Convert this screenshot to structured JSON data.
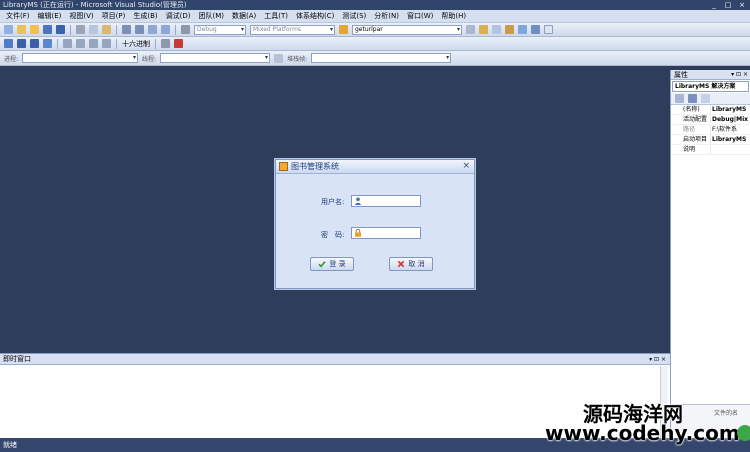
{
  "window": {
    "title": "LibraryMS (正在运行) - Microsoft Visual Studio(管理员)"
  },
  "menu": [
    "文件(F)",
    "编辑(E)",
    "视图(V)",
    "项目(P)",
    "生成(B)",
    "调试(D)",
    "团队(M)",
    "数据(A)",
    "工具(T)",
    "体系结构(C)",
    "测试(S)",
    "分析(N)",
    "窗口(W)",
    "帮助(H)"
  ],
  "toolbar1": {
    "config": "Debug",
    "platform": "Mixed Platforms",
    "find": "geturlpar"
  },
  "toolbar2": {
    "hex_label": "十六进制"
  },
  "toolbar3": {
    "process_label": "进程:",
    "thread_label": "线程:",
    "stack_label": "堆栈帧:"
  },
  "properties": {
    "title": "属性",
    "object": "LibraryMS 解决方案",
    "rows": [
      {
        "name": "(名称)",
        "value": "LibraryMS"
      },
      {
        "name": "活动配置",
        "value": "Debug|Mix"
      },
      {
        "name": "路径",
        "value": "F:\\软件系"
      },
      {
        "name": "启动项目",
        "value": "LibraryMS"
      },
      {
        "name": "说明",
        "value": ""
      }
    ],
    "desc": "文件的名"
  },
  "immediate": {
    "title": "即时窗口"
  },
  "status": {
    "text": "就绪"
  },
  "dialog": {
    "title": "图书管理系统",
    "username_label": "用户名:",
    "password_label": "密　码:",
    "login_label": "登 录",
    "cancel_label": "取 消",
    "username_value": "",
    "password_value": ""
  },
  "watermark": {
    "line1": "源码海洋网",
    "line2": "www.codehy.com"
  },
  "colors": {
    "workspace": "#2f3d5c",
    "dialog_bg": "#d8e4f6",
    "accent": "#1d3d78"
  }
}
